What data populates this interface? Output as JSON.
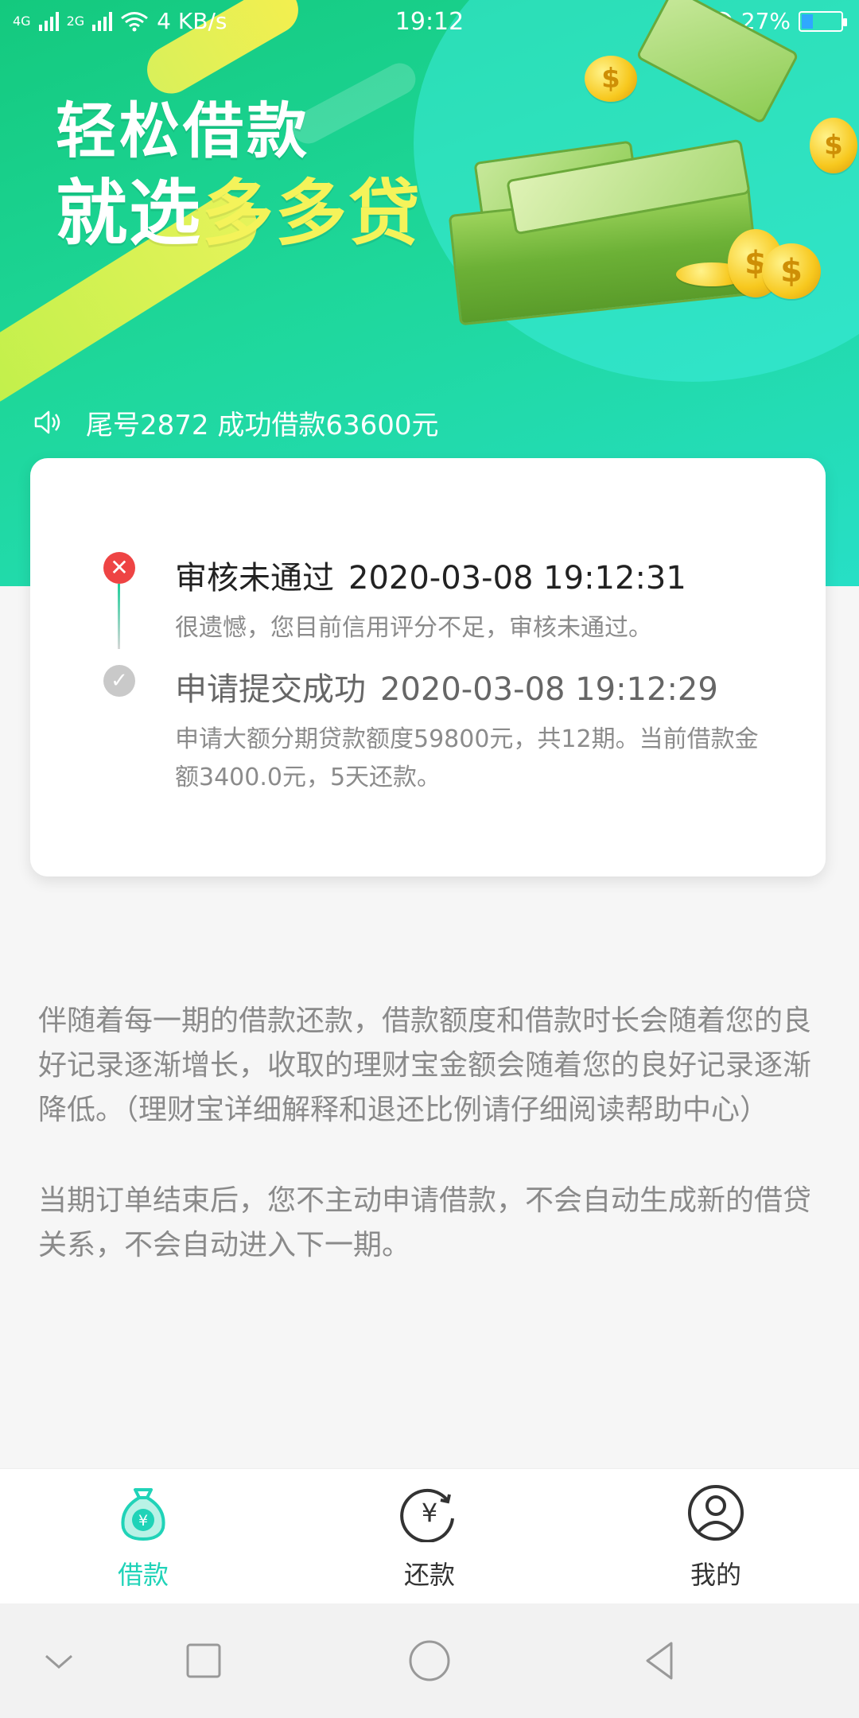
{
  "status_bar": {
    "network1": "4G",
    "network2": "2G",
    "speed": "4 KB/s",
    "time": "19:12",
    "battery": "27%",
    "battery_level": 0.27
  },
  "hero": {
    "title_line1": "轻松借款",
    "title_prefix": "就选",
    "title_brand": "多多贷",
    "ticker": "尾号2872 成功借款63600元"
  },
  "timeline": [
    {
      "status": "审核未通过",
      "timestamp": "2020-03-08 19:12:31",
      "description": "很遗憾，您目前信用评分不足，审核未通过。",
      "state": "failed"
    },
    {
      "status": "申请提交成功",
      "timestamp": "2020-03-08 19:12:29",
      "description": "申请大额分期贷款额度59800元，共12期。当前借款金额3400.0元，5天还款。",
      "state": "done"
    }
  ],
  "info": {
    "paragraph1": "伴随着每一期的借款还款，借款额度和借款时长会随着您的良好记录逐渐增长，收取的理财宝金额会随着您的良好记录逐渐降低。（理财宝详细解释和退还比例请仔细阅读帮助中心）",
    "paragraph2": "当期订单结束后，您不主动申请借款，不会自动生成新的借贷关系，不会自动进入下一期。"
  },
  "tabs": [
    {
      "label": "借款",
      "icon": "money-bag-icon",
      "active": true
    },
    {
      "label": "还款",
      "icon": "repay-yen-icon",
      "active": false
    },
    {
      "label": "我的",
      "icon": "profile-icon",
      "active": false
    }
  ],
  "colors": {
    "accent": "#20d3b8",
    "hero_start": "#14c97e",
    "hero_end": "#27dfc6",
    "brand_yellow": "#f4f35a",
    "fail_red": "#ee4444"
  }
}
